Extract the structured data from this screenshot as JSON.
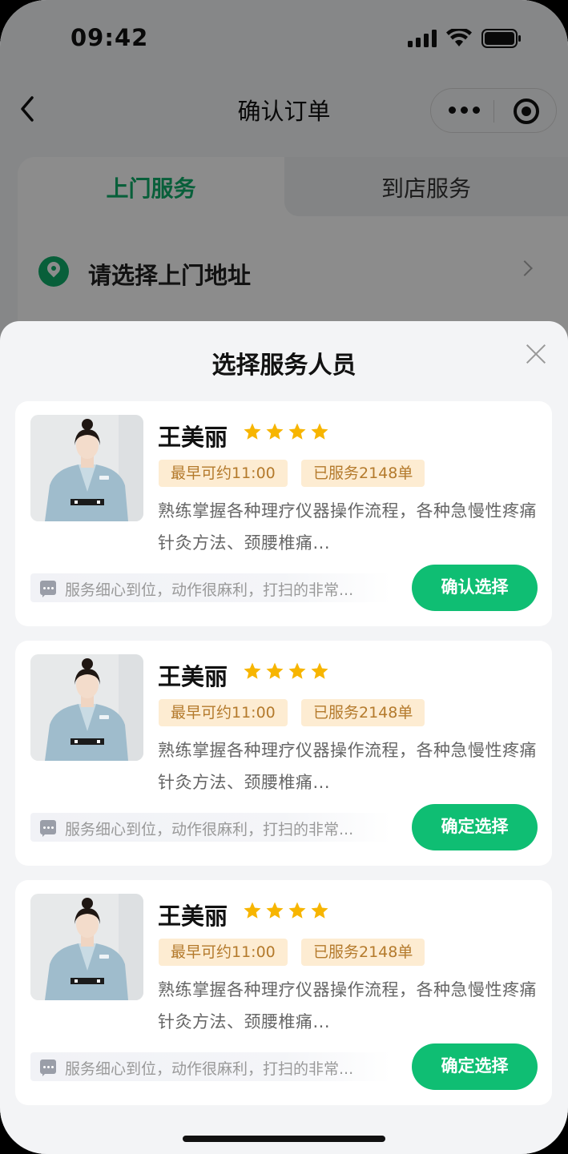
{
  "status_bar": {
    "time": "09:42"
  },
  "nav": {
    "title": "确认订单"
  },
  "tabs": [
    {
      "label": "上门服务",
      "active": true
    },
    {
      "label": "到店服务",
      "active": false
    }
  ],
  "address": {
    "label": "请选择上门地址"
  },
  "sheet": {
    "title": "选择服务人员",
    "staff": [
      {
        "name": "王美丽",
        "rating": 4,
        "tag_earliest": "最早可约11:00",
        "tag_served": "已服务2148单",
        "description": "熟练掌握各种理疗仪器操作流程，各种急慢性疼痛针灸方法、颈腰椎痛...",
        "review": "服务细心到位，动作很麻利，打扫的非常...",
        "button_label": "确认选择"
      },
      {
        "name": "王美丽",
        "rating": 4,
        "tag_earliest": "最早可约11:00",
        "tag_served": "已服务2148单",
        "description": "熟练掌握各种理疗仪器操作流程，各种急慢性疼痛针灸方法、颈腰椎痛...",
        "review": "服务细心到位，动作很麻利，打扫的非常...",
        "button_label": "确定选择"
      },
      {
        "name": "王美丽",
        "rating": 4,
        "tag_earliest": "最早可约11:00",
        "tag_served": "已服务2148单",
        "description": "熟练掌握各种理疗仪器操作流程，各种急慢性疼痛针灸方法、颈腰椎痛...",
        "review": "服务细心到位，动作很麻利，打扫的非常...",
        "button_label": "确定选择"
      }
    ]
  },
  "colors": {
    "accent_green": "#0fbe73",
    "tab_active_green": "#0fae6a",
    "star_yellow": "#f7b500",
    "tag_bg": "#fdecd2",
    "tag_text": "#b47a2c"
  }
}
